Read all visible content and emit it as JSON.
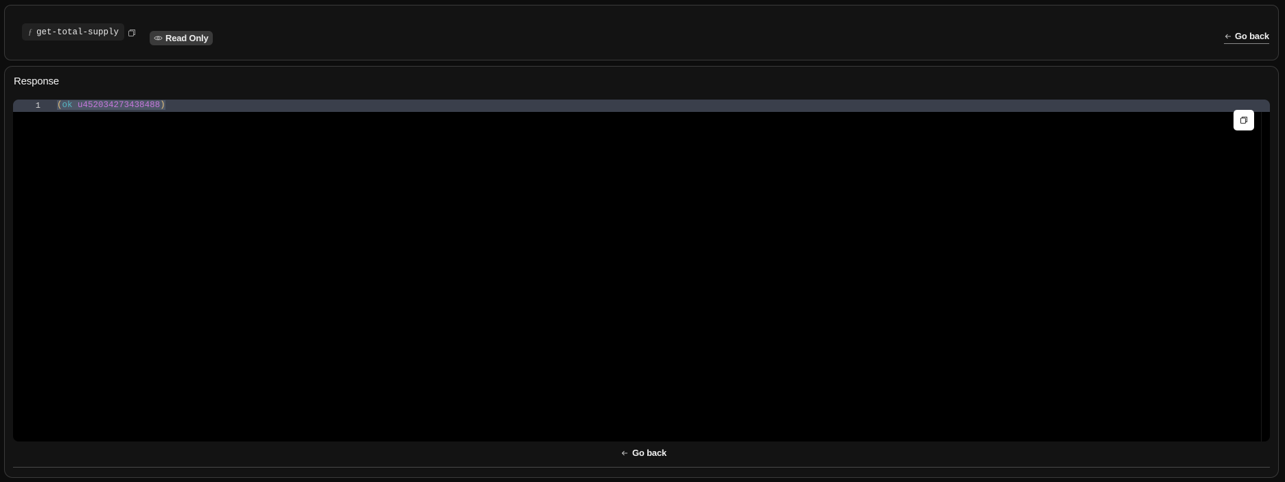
{
  "header": {
    "function_icon": "function-icon",
    "function_name": "get-total-supply",
    "copy_icon": "copy-icon",
    "badge": {
      "icon": "eye-icon",
      "label": "Read Only"
    },
    "go_back": {
      "icon": "arrow-left-icon",
      "label": "Go back"
    }
  },
  "response": {
    "title": "Response",
    "editor": {
      "line_numbers": [
        "1"
      ],
      "tokens": {
        "open": "(",
        "keyword": "ok",
        "value": "u452034273438488",
        "close": ")"
      }
    },
    "copy_icon": "copy-icon",
    "go_back": {
      "icon": "arrow-left-icon",
      "label": "Go back"
    }
  },
  "colors": {
    "background": "#0d0d0d",
    "panel": "#131313",
    "panel_border": "#3a3a3a",
    "editor_bg": "#000000",
    "active_line": "#3a3f4b",
    "paren": "#e5c07b",
    "keyword": "#56b6c2",
    "number": "#c678dd"
  }
}
